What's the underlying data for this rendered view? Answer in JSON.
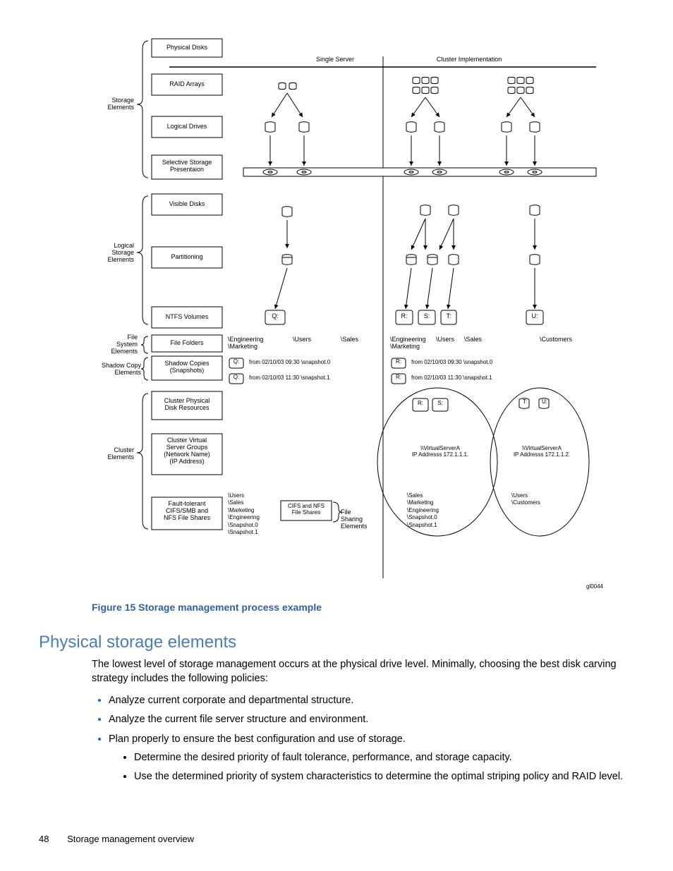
{
  "diagram": {
    "column_headers": {
      "single": "Single Server",
      "cluster": "Cluster Implementation"
    },
    "category_labels": {
      "storage_elements": "Storage\nElements",
      "logical_storage_elements": "Logical\nStorage\nElements",
      "file_system_elements": "File\nSystem\nElements",
      "shadow_copy_elements": "Shadow Copy\nElements",
      "cluster_elements": "Cluster\nElements",
      "file_sharing_elements": "File\nSharing\nElements"
    },
    "row_labels": {
      "physical_disks": "Physical Disks",
      "raid_arrays": "RAID Arrays",
      "logical_drives": "Logical Drives",
      "ssp": "Selective Storage\nPresentaion",
      "visible_disks": "Visible Disks",
      "partitioning": "Partitioning",
      "ntfs_volumes": "NTFS Volumes",
      "file_folders": "File Folders",
      "shadow_copies": "Shadow Copies\n(Snapshots)",
      "cluster_physical": "Cluster Physical\nDisk Resources",
      "cluster_virtual": "Cluster Virtual\nServer Groups\n(Network Name)\n(IP Address)",
      "shares": "Fault-tolerant\nCIFS/SMB and\nNFS File Shares"
    },
    "drive_letters": {
      "q": "Q:",
      "r": "R:",
      "s": "S:",
      "t": "T:",
      "u": "U:"
    },
    "folders": {
      "single_eng_mkt": "\\Engineering\n\\Marketing",
      "single_users": "\\Users",
      "single_sales": "\\Sales",
      "cluster_eng_mkt": "\\Engineering\n\\Marketing",
      "cluster_users": "\\Users",
      "cluster_sales": "\\Sales",
      "cluster_customers": "\\Customers"
    },
    "snapshots": {
      "s0_single": "from 02/10/03 09:30 \\snapshot.0",
      "s1_single": "from 02/10/03 11:30 \\snapshot.1",
      "s0_cluster": "from 02/10/03 09:30 \\snapshot.0",
      "s1_cluster": "from 02/10/03 11:30 \\snapshot.1",
      "q_badge": "Q:",
      "r_badge": "R:"
    },
    "virtual_servers": {
      "a": "\\\\VirtualServerA\nIP Addresss 172.1.1.1.",
      "b": "\\\\VirtualServerA\nIP Addresss 172.1.1.2."
    },
    "shares_lists": {
      "single": "\\Users\n\\Sales\n\\Marketing\n\\Engineering\n\\Snapshot.0\n\\Snapshot.1",
      "cifs_nfs_box": "CIFS and NFS\nFile Shares",
      "cluster_a": "\\Sales\n\\Marketing\n\\Engineering\n\\Snapshot.0\n\\Snapshot.1",
      "cluster_b": "\\Users\n\\Customers"
    },
    "watermark": "gl0044"
  },
  "figure_caption": "Figure 15 Storage management process example",
  "section_heading": "Physical storage elements",
  "body_p1": "The lowest level of storage management occurs at the physical drive level. Minimally, choosing the best disk carving strategy includes the following policies:",
  "bullets": {
    "b1": "Analyze current corporate and departmental structure.",
    "b2": "Analyze the current file server structure and environment.",
    "b3": "Plan properly to ensure the best configuration and use of storage.",
    "b3a": "Determine the desired priority of fault tolerance, performance, and storage capacity.",
    "b3b": "Use the determined priority of system characteristics to determine the optimal striping policy and RAID level."
  },
  "footer": {
    "page": "48",
    "title": "Storage management overview"
  }
}
